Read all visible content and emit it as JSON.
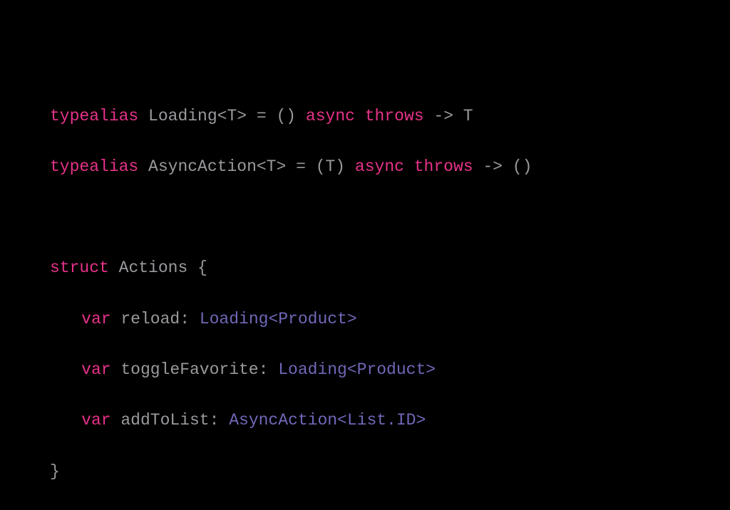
{
  "keywords": {
    "typealias": "typealias",
    "struct": "struct",
    "var": "var",
    "async": "async",
    "throws": "throws"
  },
  "decl": {
    "loading_name": "Loading",
    "loading_generic": "<T>",
    "loading_eq": " = () ",
    "loading_arrow": " -> T",
    "asyncaction_name": "AsyncAction",
    "asyncaction_generic": "<T>",
    "asyncaction_eq": " = (T) ",
    "asyncaction_arrow": " -> ()",
    "struct_name": "Actions",
    "struct_open": " {",
    "struct_close": "}"
  },
  "members": {
    "reload_name": " reload: ",
    "reload_type": "Loading",
    "reload_generic": "<Product>",
    "toggle_name": " toggleFavorite: ",
    "toggle_type": "Loading",
    "toggle_generic": "<Product>",
    "addtolist_name": " addToList: ",
    "addtolist_type": "AsyncAction",
    "addtolist_generic": "<List.ID>"
  },
  "punct": {
    "space": " "
  }
}
